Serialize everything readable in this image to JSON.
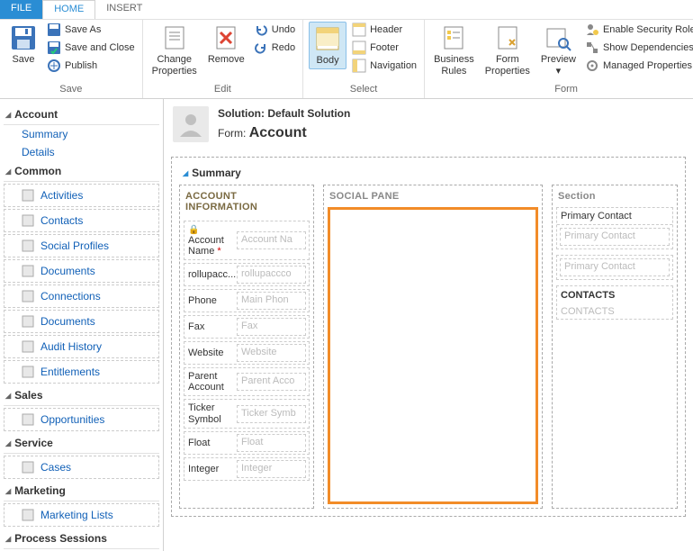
{
  "ribbon": {
    "tabs": {
      "file": "FILE",
      "home": "HOME",
      "insert": "INSERT"
    },
    "save": {
      "save": "Save",
      "save_as": "Save As",
      "save_close": "Save and Close",
      "publish": "Publish",
      "group": "Save"
    },
    "edit": {
      "change_properties": "Change\nProperties",
      "remove": "Remove",
      "undo": "Undo",
      "redo": "Redo",
      "group": "Edit"
    },
    "select": {
      "body": "Body",
      "header": "Header",
      "footer": "Footer",
      "navigation": "Navigation",
      "group": "Select"
    },
    "form_group": {
      "business_rules": "Business\nRules",
      "form_properties": "Form\nProperties",
      "preview": "Preview",
      "enable_security": "Enable Security Roles",
      "show_dependencies": "Show Dependencies",
      "managed_properties": "Managed Properties",
      "group": "Form"
    }
  },
  "sidebar": {
    "account": {
      "hdr": "Account",
      "summary": "Summary",
      "details": "Details"
    },
    "common": {
      "hdr": "Common",
      "items": [
        "Activities",
        "Contacts",
        "Social Profiles",
        "Documents",
        "Connections",
        "Documents",
        "Audit History",
        "Entitlements"
      ]
    },
    "sales": {
      "hdr": "Sales",
      "items": [
        "Opportunities"
      ]
    },
    "service": {
      "hdr": "Service",
      "items": [
        "Cases"
      ]
    },
    "marketing": {
      "hdr": "Marketing",
      "items": [
        "Marketing Lists"
      ]
    },
    "process": {
      "hdr": "Process Sessions"
    }
  },
  "header": {
    "solution_label": "Solution:",
    "solution_name": "Default Solution",
    "form_label": "Form:",
    "form_name": "Account"
  },
  "canvas": {
    "summary": "Summary",
    "col1_hdr": "ACCOUNT INFORMATION",
    "col2_hdr": "SOCIAL PANE",
    "col3_hdr": "Section",
    "fields": [
      {
        "label": "Account Name",
        "placeholder": "Account Na",
        "locked": true,
        "required": true
      },
      {
        "label": "rollupacc...",
        "placeholder": "rollupaccco"
      },
      {
        "label": "Phone",
        "placeholder": "Main Phon"
      },
      {
        "label": "Fax",
        "placeholder": "Fax"
      },
      {
        "label": "Website",
        "placeholder": "Website"
      },
      {
        "label": "Parent Account",
        "placeholder": "Parent Acco"
      },
      {
        "label": "Ticker Symbol",
        "placeholder": "Ticker Symb"
      },
      {
        "label": "Float",
        "placeholder": "Float"
      },
      {
        "label": "Integer",
        "placeholder": "Integer"
      }
    ],
    "col3": {
      "primary_contact": "Primary Contact",
      "primary_contact_ph": "Primary Contact",
      "primary_contact_ph2": "Primary Contact",
      "contacts_hdr": "CONTACTS",
      "contacts_body": "CONTACTS"
    }
  }
}
